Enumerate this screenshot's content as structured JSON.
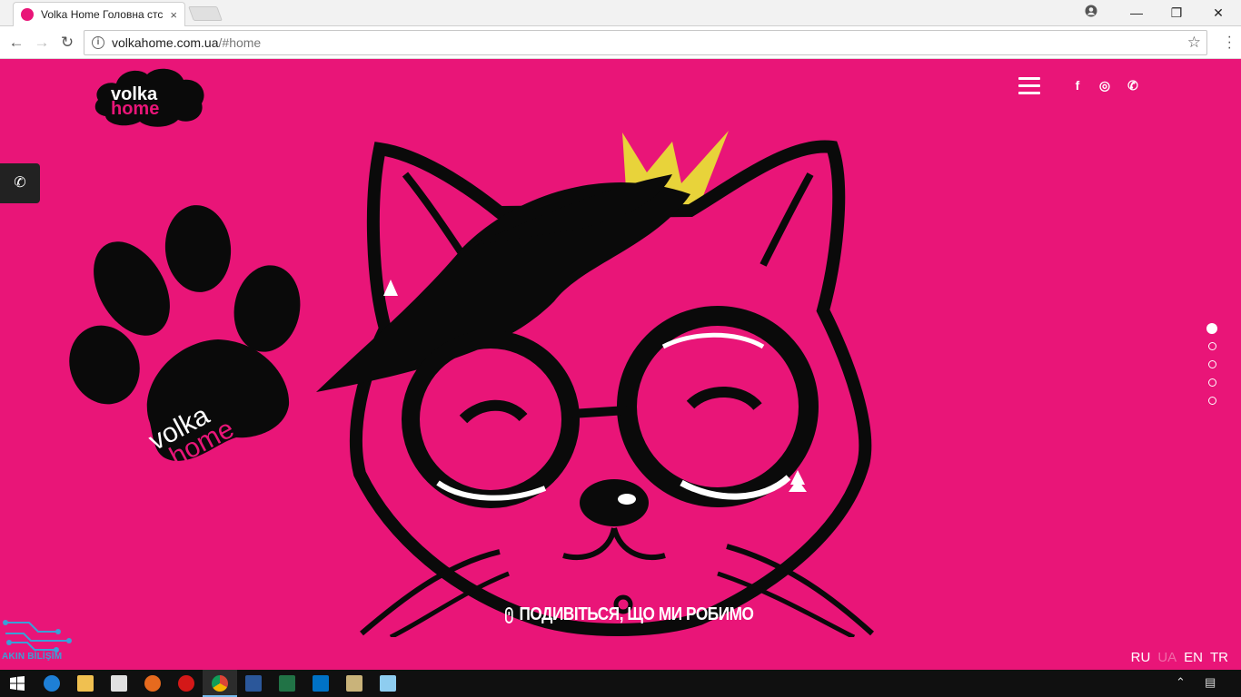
{
  "browser": {
    "tab_title": "Volka Home Головна стс",
    "tab_close": "×",
    "url_host": "volkahome.com.ua",
    "url_path": "/#home",
    "window_buttons": {
      "minimize": "—",
      "restore": "❐",
      "close": "✕"
    }
  },
  "page": {
    "logo_text_top": "volka",
    "logo_text_bottom": "home",
    "paw_text_top": "volka",
    "paw_text_bottom": "home",
    "nav_icons": [
      "menu-icon",
      "facebook-icon",
      "instagram-icon",
      "phone-icon"
    ],
    "social": {
      "facebook": "f",
      "instagram": "◎",
      "phone": "✆"
    },
    "side_phone": "✆",
    "cta_text": "ПОДИВІТЬСЯ, ЩО МИ РОБИМО",
    "slider_dots": 5,
    "languages": [
      {
        "code": "RU",
        "active": false
      },
      {
        "code": "UA",
        "active": true
      },
      {
        "code": "EN",
        "active": false
      },
      {
        "code": "TR",
        "active": false
      }
    ],
    "watermark": "AKIN BİLİŞİM"
  },
  "colors": {
    "brand_pink": "#e91578",
    "crown_yellow": "#e8d33a",
    "black": "#0a0a0a"
  },
  "taskbar": {
    "icons": [
      "windows-start-icon",
      "edge-icon",
      "file-explorer-icon",
      "store-icon",
      "firefox-icon",
      "opera-icon",
      "chrome-icon",
      "word-icon",
      "excel-icon",
      "outlook-icon",
      "paint-icon",
      "notepad-icon"
    ],
    "tray": [
      "chevron-up-icon",
      "notification-icon"
    ]
  }
}
